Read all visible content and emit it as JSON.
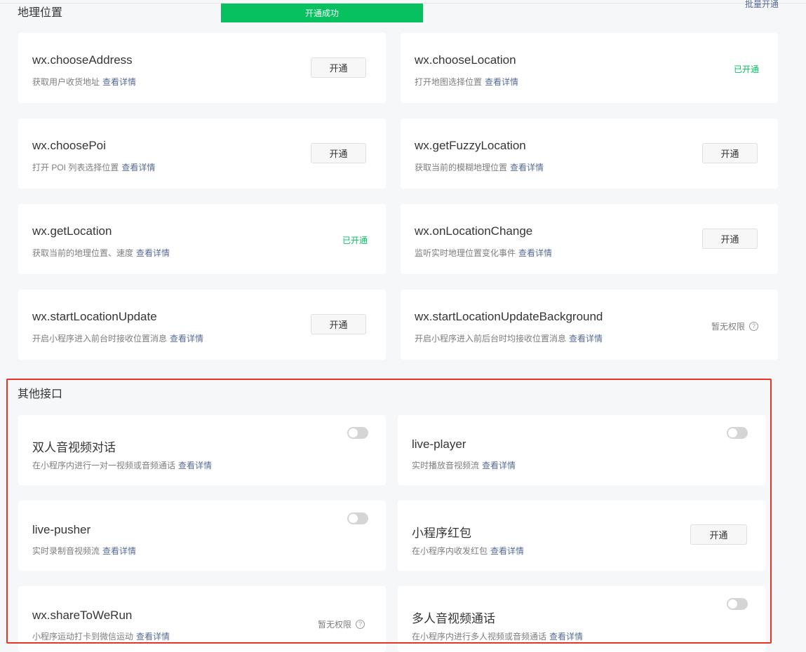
{
  "section_location": {
    "title": "地理位置",
    "batch_link": "批量开通"
  },
  "toast": "开通成功",
  "location_cards": [
    {
      "name": "wx.chooseAddress",
      "desc": "获取用户收货地址",
      "link": "查看详情",
      "state": "开通"
    },
    {
      "name": "wx.chooseLocation",
      "desc": "打开地图选择位置",
      "link": "查看详情",
      "state": "已开通"
    },
    {
      "name": "wx.choosePoi",
      "desc": "打开 POI 列表选择位置",
      "link": "查看详情",
      "state": "开通"
    },
    {
      "name": "wx.getFuzzyLocation",
      "desc": "获取当前的模糊地理位置",
      "link": "查看详情",
      "state": "开通"
    },
    {
      "name": "wx.getLocation",
      "desc": "获取当前的地理位置、速度",
      "link": "查看详情",
      "state": "已开通"
    },
    {
      "name": "wx.onLocationChange",
      "desc": "监听实时地理位置变化事件",
      "link": "查看详情",
      "state": "开通"
    },
    {
      "name": "wx.startLocationUpdate",
      "desc": "开启小程序进入前台时接收位置消息",
      "link": "查看详情",
      "state": "开通"
    },
    {
      "name": "wx.startLocationUpdateBackground",
      "desc": "开启小程序进入前后台时均接收位置消息",
      "link": "查看详情",
      "state": "暂无权限"
    }
  ],
  "section_other": {
    "title": "其他接口"
  },
  "other_cards": [
    {
      "name": "双人音视频对话",
      "desc": "在小程序内进行一对一视频或音频通话",
      "link": "查看详情",
      "control": "toggle",
      "enabled": false
    },
    {
      "name": "live-player",
      "desc": "实时播放音视频流",
      "link": "查看详情",
      "control": "toggle",
      "enabled": false
    },
    {
      "name": "live-pusher",
      "desc": "实时录制音视频流",
      "link": "查看详情",
      "control": "toggle",
      "enabled": false
    },
    {
      "name": "小程序红包",
      "desc": "在小程序内收发红包",
      "link": "查看详情",
      "control": "button",
      "state": "开通"
    },
    {
      "name": "wx.shareToWeRun",
      "desc": "小程序运动打卡到微信运动",
      "link": "查看详情",
      "control": "noperm",
      "state": "暂无权限"
    },
    {
      "name": "多人音视频通话",
      "desc": "在小程序内进行多人视频或音频通话",
      "link": "查看详情",
      "control": "toggle",
      "enabled": false
    }
  ],
  "colors": {
    "accent": "#07c160",
    "link": "#576b95",
    "highlight_box": "#e8332b"
  }
}
